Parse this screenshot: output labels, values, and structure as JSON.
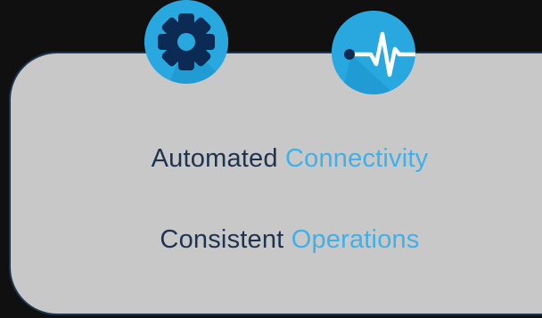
{
  "icons": {
    "left": "gear-icon",
    "right": "heartbeat-pulse-icon"
  },
  "lines": [
    {
      "part1": "Automated",
      "part2": "C",
      "part3": "onnectivity"
    },
    {
      "part1": "Consistent",
      "part2": "Operations"
    }
  ],
  "colors": {
    "background": "#101010",
    "panel": "#c8c8c8",
    "panel_border": "#1e3550",
    "dark_text": "#1d3350",
    "accent_blue": "#3fb0e8",
    "icon_blue": "#29a8e0",
    "icon_navy": "#0b2a54"
  }
}
